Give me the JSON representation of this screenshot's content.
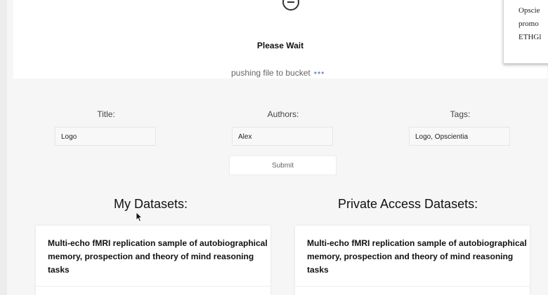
{
  "modal": {
    "title": "Please Wait",
    "status_text": "pushing file to bucket",
    "status_dots": "•••"
  },
  "tooltip": {
    "lines": [
      "Opscie",
      "promo",
      "ETHGl"
    ]
  },
  "form": {
    "title_label": "Title:",
    "title_value": "Logo",
    "authors_label": "Authors:",
    "authors_value": "Alex",
    "tags_label": "Tags:",
    "tags_value": "Logo, Opscientia",
    "submit_label": "Submit"
  },
  "sections": {
    "my_datasets": {
      "heading": "My Datasets:",
      "card_title": "Multi-echo fMRI replication sample of autobiographical memory, prospection and theory of mind reasoning tasks"
    },
    "private_datasets": {
      "heading": "Private Access Datasets:",
      "card_title": "Multi-echo fMRI replication sample of autobiographical memory, prospection and theory of mind reasoning tasks"
    }
  }
}
